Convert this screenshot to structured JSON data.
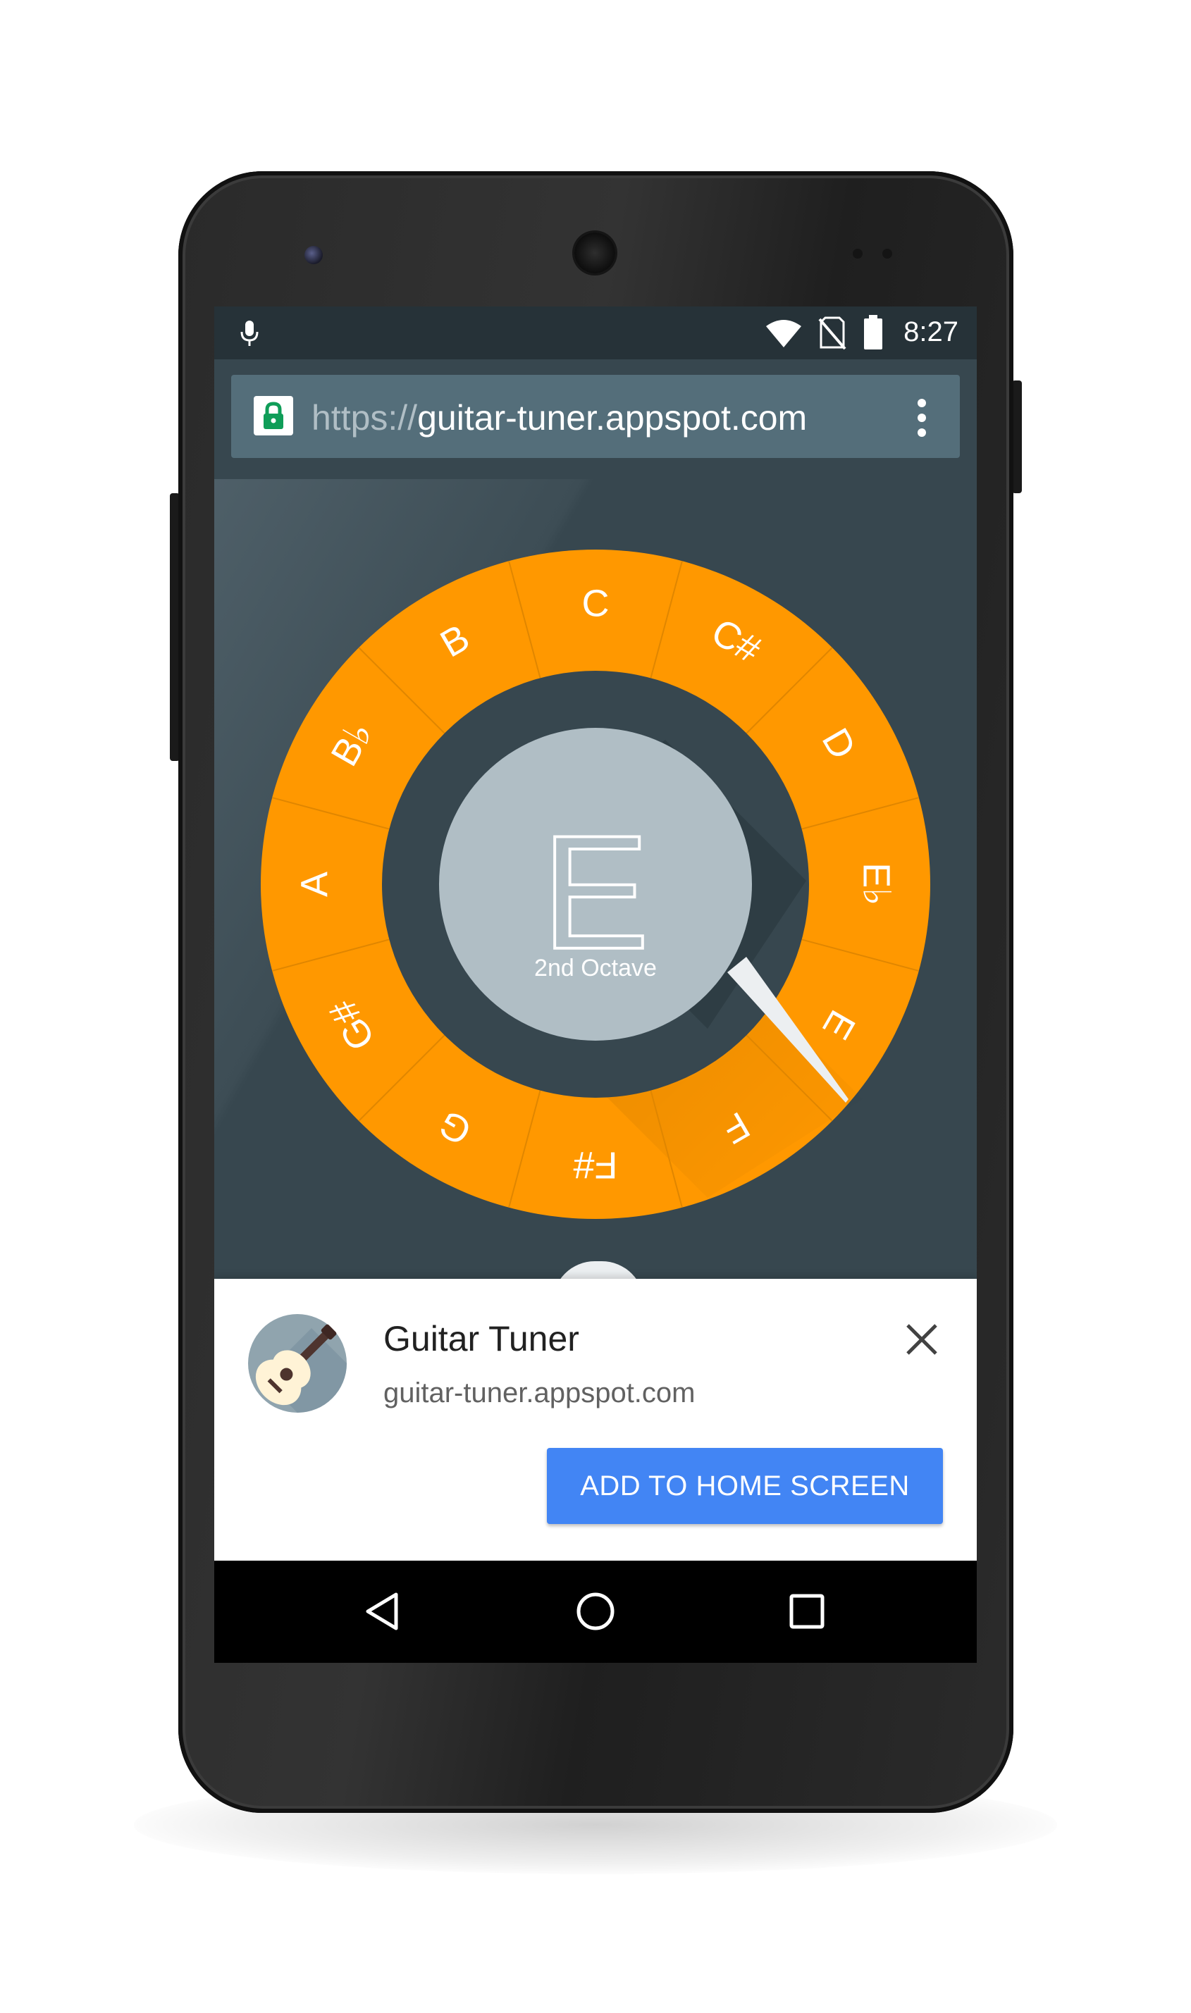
{
  "status_bar": {
    "time": "8:27",
    "icons": [
      "mic-icon",
      "wifi-icon",
      "no-sim-icon",
      "battery-icon"
    ]
  },
  "url_bar": {
    "scheme": "https://",
    "host": "guitar-tuner.appspot.com",
    "lock_icon": "lock-icon",
    "menu_icon": "overflow-menu-icon"
  },
  "tuner": {
    "ring_notes": [
      "C",
      "C#",
      "D",
      "E♭",
      "E",
      "F",
      "F#",
      "G",
      "G#",
      "A",
      "B♭",
      "B"
    ],
    "current_note": "E",
    "octave_label": "2nd Octave"
  },
  "install_banner": {
    "app_name": "Guitar Tuner",
    "app_url": "guitar-tuner.appspot.com",
    "add_button_label": "ADD TO HOME SCREEN",
    "icon": "guitar-icon",
    "close_icon": "close-icon"
  },
  "nav_bar": {
    "items": [
      "back-icon",
      "home-icon",
      "recents-icon"
    ]
  },
  "colors": {
    "ring": "#ff9800",
    "background": "#37474f",
    "center": "#b0bec5",
    "accent_button": "#4285f4",
    "lock_green": "#0f9d58"
  }
}
